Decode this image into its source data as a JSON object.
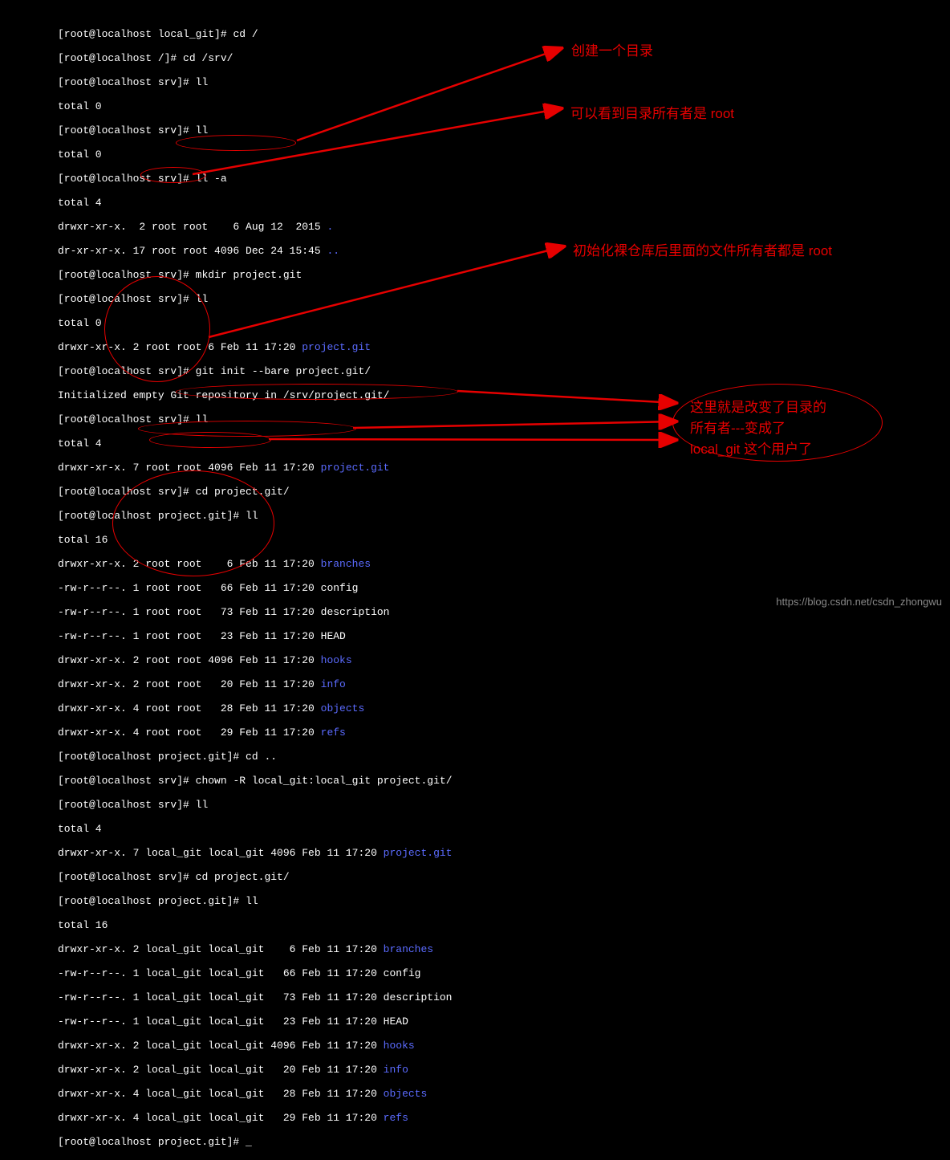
{
  "terminal": {
    "prompt_local_git": "[root@localhost local_git]# ",
    "prompt_slash": "[root@localhost /]# ",
    "prompt_srv": "[root@localhost srv]# ",
    "prompt_project": "[root@localhost project.git]# ",
    "cmd_cd_root": "cd /",
    "cmd_cd_srv": "cd /srv/",
    "cmd_ll": "ll",
    "cmd_ll_a": "ll -a",
    "cmd_mkdir": "mkdir project.git",
    "cmd_git_init": "git init --bare project.git/",
    "cmd_cd_project": "cd project.git/",
    "cmd_cd_up": "cd ..",
    "cmd_chown": "chown -R local_git:local_git project.git/",
    "total0": "total 0",
    "total4": "total 4",
    "total16": "total 16",
    "ls_a_1": "drwxr-xr-x.  2 root root    6 Aug 12  2015 ",
    "ls_a_1_dot": ".",
    "ls_a_2": "dr-xr-xr-x. 17 root root 4096 Dec 24 15:45 ",
    "ls_a_2_dot": "..",
    "ls_proj_root": "drwxr-xr-x. 2 root root 6 Feb 11 17:20 ",
    "proj_git": "project.git",
    "git_init_msg": "Initialized empty Git repository in /srv/project.git/",
    "ls_proj_root2": "drwxr-xr-x. 7 root root 4096 Feb 11 17:20 ",
    "files_root": [
      {
        "perm": "drwxr-xr-x. 2 root root    6 Feb 11 17:20 ",
        "name": "branches",
        "blue": true
      },
      {
        "perm": "-rw-r--r--. 1 root root   66 Feb 11 17:20 ",
        "name": "config",
        "blue": false
      },
      {
        "perm": "-rw-r--r--. 1 root root   73 Feb 11 17:20 ",
        "name": "description",
        "blue": false
      },
      {
        "perm": "-rw-r--r--. 1 root root   23 Feb 11 17:20 ",
        "name": "HEAD",
        "blue": false
      },
      {
        "perm": "drwxr-xr-x. 2 root root 4096 Feb 11 17:20 ",
        "name": "hooks",
        "blue": true
      },
      {
        "perm": "drwxr-xr-x. 2 root root   20 Feb 11 17:20 ",
        "name": "info",
        "blue": true
      },
      {
        "perm": "drwxr-xr-x. 4 root root   28 Feb 11 17:20 ",
        "name": "objects",
        "blue": true
      },
      {
        "perm": "drwxr-xr-x. 4 root root   29 Feb 11 17:20 ",
        "name": "refs",
        "blue": true
      }
    ],
    "ls_proj_lg": "drwxr-xr-x. 7 local_git local_git 4096 Feb 11 17:20 ",
    "files_lg": [
      {
        "perm": "drwxr-xr-x. 2 local_git local_git    6 Feb 11 17:20 ",
        "name": "branches",
        "blue": true
      },
      {
        "perm": "-rw-r--r--. 1 local_git local_git   66 Feb 11 17:20 ",
        "name": "config",
        "blue": false
      },
      {
        "perm": "-rw-r--r--. 1 local_git local_git   73 Feb 11 17:20 ",
        "name": "description",
        "blue": false
      },
      {
        "perm": "-rw-r--r--. 1 local_git local_git   23 Feb 11 17:20 ",
        "name": "HEAD",
        "blue": false
      },
      {
        "perm": "drwxr-xr-x. 2 local_git local_git 4096 Feb 11 17:20 ",
        "name": "hooks",
        "blue": true
      },
      {
        "perm": "drwxr-xr-x. 2 local_git local_git   20 Feb 11 17:20 ",
        "name": "info",
        "blue": true
      },
      {
        "perm": "drwxr-xr-x. 4 local_git local_git   28 Feb 11 17:20 ",
        "name": "objects",
        "blue": true
      },
      {
        "perm": "drwxr-xr-x. 4 local_git local_git   29 Feb 11 17:20 ",
        "name": "refs",
        "blue": true
      }
    ],
    "cursor": "_"
  },
  "annotations": {
    "a1": "创建一个目录",
    "a2": "可以看到目录所有者是 root",
    "a3": "初始化裸仓库后里面的文件所有者都是 root",
    "a4_1": "这里就是改变了目录的",
    "a4_2": "所有者---变成了",
    "a4_3": "local_git 这个用户了"
  },
  "watermark": "https://blog.csdn.net/csdn_zhongwu"
}
